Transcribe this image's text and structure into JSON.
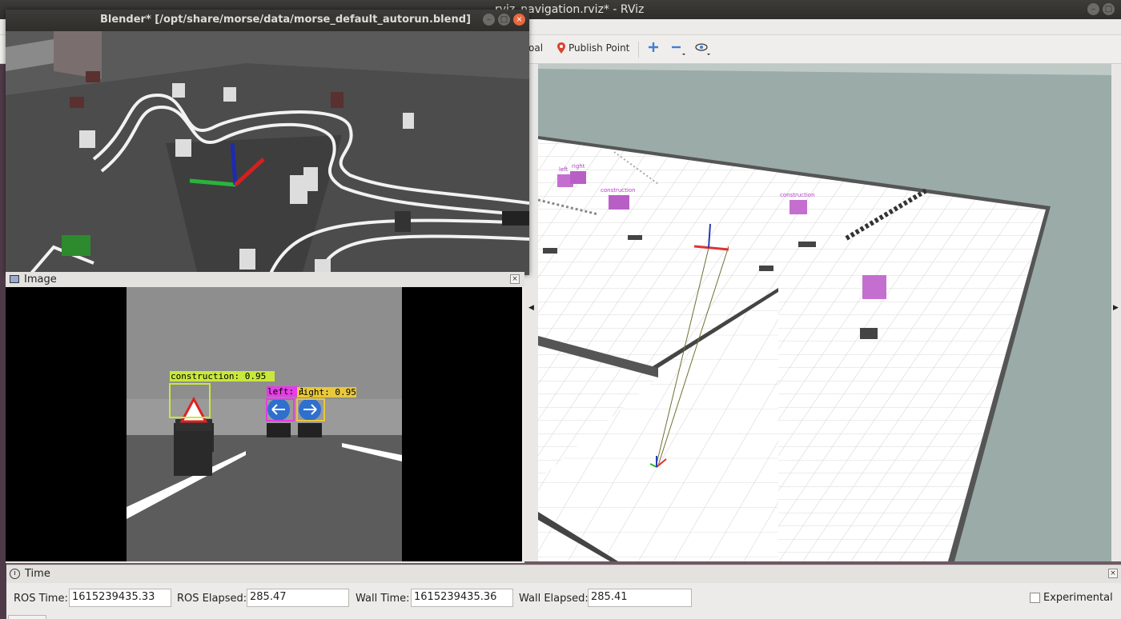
{
  "rviz": {
    "title": "rviz_navigation.rviz* - RViz",
    "toolbar": {
      "partial_goal_label": "oal",
      "publish_point_label": "Publish Point",
      "move_camera_icon": "plus-move-icon",
      "remove_icon": "minus-icon",
      "eye_icon": "eye-icon"
    },
    "scene_labels": [
      {
        "text": "left"
      },
      {
        "text": "right"
      },
      {
        "text": "construction"
      },
      {
        "text": "construction"
      }
    ],
    "colors": {
      "viewport_bg": "#9aaba8",
      "marker": "#c46fcf",
      "grid": "#ffffff"
    }
  },
  "blender": {
    "title": "Blender* [/opt/share/morse/data/morse_default_autorun.blend]"
  },
  "image_panel": {
    "title": "Image",
    "detections": [
      {
        "label": "construction: 0.95",
        "color": "#c8e83c"
      },
      {
        "label": "left: 1",
        "color": "#e63ce6"
      },
      {
        "label": "right: 0.95",
        "color": "#e8c83c"
      }
    ]
  },
  "time_panel": {
    "title": "Time",
    "ros_time_label": "ROS Time:",
    "ros_time": "1615239435.33",
    "ros_elapsed_label": "ROS Elapsed:",
    "ros_elapsed": "285.47",
    "wall_time_label": "Wall Time:",
    "wall_time": "1615239435.36",
    "wall_elapsed_label": "Wall Elapsed:",
    "wall_elapsed": "285.41",
    "experimental_label": "Experimental",
    "experimental_checked": false
  }
}
